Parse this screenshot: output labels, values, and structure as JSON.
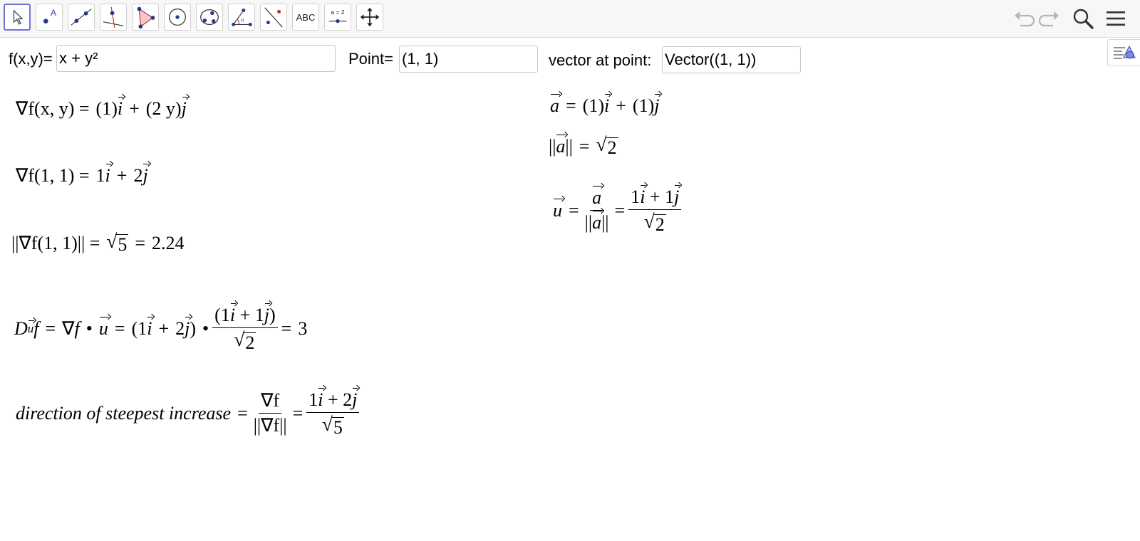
{
  "toolbar": {
    "tools": [
      {
        "name": "move-tool",
        "label": ""
      },
      {
        "name": "point-tool",
        "label": "A"
      },
      {
        "name": "line-tool",
        "label": ""
      },
      {
        "name": "perpendicular-line-tool",
        "label": ""
      },
      {
        "name": "polygon-tool",
        "label": ""
      },
      {
        "name": "circle-tool",
        "label": ""
      },
      {
        "name": "ellipse-tool",
        "label": ""
      },
      {
        "name": "angle-tool",
        "label": "α"
      },
      {
        "name": "reflect-tool",
        "label": ""
      },
      {
        "name": "text-tool",
        "label": "ABC"
      },
      {
        "name": "slider-tool",
        "label": "a = 2"
      },
      {
        "name": "move-graphics-view-tool",
        "label": ""
      }
    ],
    "right_icons": [
      "undo-icon",
      "redo-icon",
      "search-icon",
      "menu-icon"
    ],
    "accent": "#6f72d8"
  },
  "inputs": {
    "f": {
      "label": "f(x,y)=",
      "value": "x + y²"
    },
    "point": {
      "label": "Point=",
      "value": "(1, 1)"
    },
    "vector": {
      "label": "vector at point:",
      "value": "Vector((1, 1))"
    }
  },
  "math": {
    "grad_general": {
      "lhs": "∇f(x, y) =",
      "coef_i": "(1)",
      "plus": "+",
      "coef_j": "(2 y)"
    },
    "grad_point": {
      "lhs": "∇f(1, 1) =",
      "coef_i": "1",
      "plus": "+",
      "coef_j": "2"
    },
    "grad_norm": {
      "lhs": "||∇f(1, 1)|| =",
      "radicand": "5",
      "eq": "=",
      "value": "2.24"
    },
    "directional": {
      "lhs": "D",
      "rhs_value": "3",
      "frac_num_i": "(1",
      "frac_num_plus": "+ 1",
      "frac_den_radicand": "2"
    },
    "steepest": {
      "text": "direction of steepest increase",
      "num": "∇f",
      "den": "||∇f||",
      "num2_i": "1",
      "num2_plus": "+ 2",
      "den2_radicand": "5"
    },
    "vector_a": {
      "lhs": "a",
      "coef_i": "(1)",
      "plus": "+",
      "coef_j": "(1)"
    },
    "norm_a": {
      "radicand": "2"
    },
    "unit_u": {
      "lhs": "u",
      "frac2_num_i": "1",
      "frac2_num_plus": "+ 1",
      "frac2_den_radicand": "2"
    }
  }
}
